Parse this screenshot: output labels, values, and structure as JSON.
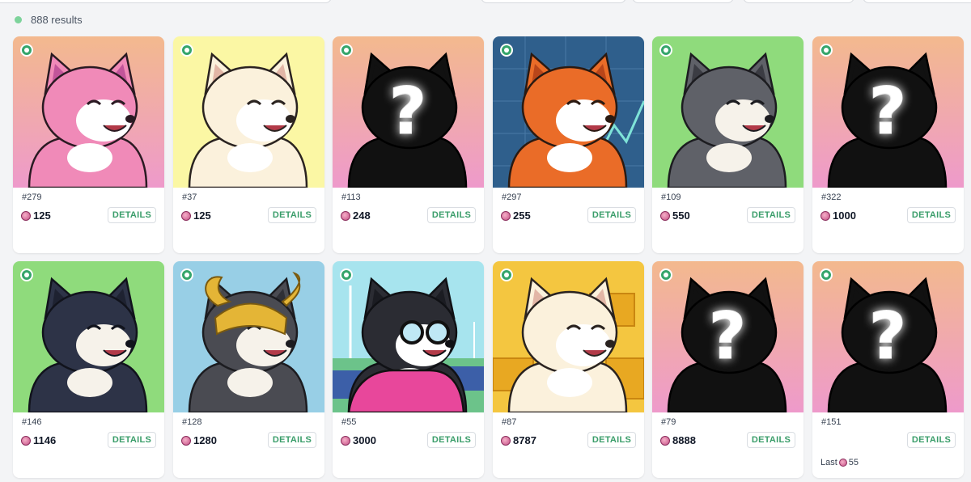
{
  "results_label": "888 results",
  "colors": {
    "accent": "#35a56b",
    "details_text": "#3a9d6a"
  },
  "cards": [
    {
      "id": "#279",
      "price": "125",
      "details": "DETAILS",
      "bg": "peach",
      "fox": "pink",
      "mask": false
    },
    {
      "id": "#37",
      "price": "125",
      "details": "DETAILS",
      "bg": "yellow",
      "fox": "cream",
      "mask": false
    },
    {
      "id": "#113",
      "price": "248",
      "details": "DETAILS",
      "bg": "peach",
      "fox": "unrevealed",
      "mask": true
    },
    {
      "id": "#297",
      "price": "255",
      "details": "DETAILS",
      "bg": "stock-chart",
      "fox": "orange",
      "mask": false
    },
    {
      "id": "#109",
      "price": "550",
      "details": "DETAILS",
      "bg": "green",
      "fox": "gray",
      "mask": false
    },
    {
      "id": "#322",
      "price": "1000",
      "details": "DETAILS",
      "bg": "peach",
      "fox": "unrevealed",
      "mask": true
    },
    {
      "id": "#146",
      "price": "1146",
      "details": "DETAILS",
      "bg": "green",
      "fox": "navy",
      "mask": false
    },
    {
      "id": "#128",
      "price": "1280",
      "details": "DETAILS",
      "bg": "light-blue",
      "fox": "horned-helmet",
      "mask": false
    },
    {
      "id": "#55",
      "price": "3000",
      "details": "DETAILS",
      "bg": "wind-farm",
      "fox": "glasses-hoodie",
      "mask": false
    },
    {
      "id": "#87",
      "price": "8787",
      "details": "DETAILS",
      "bg": "gold-bars",
      "fox": "cream",
      "mask": false
    },
    {
      "id": "#79",
      "price": "8888",
      "details": "DETAILS",
      "bg": "peach",
      "fox": "unrevealed",
      "mask": true
    },
    {
      "id": "#151",
      "price": "",
      "details": "DETAILS",
      "bg": "peach",
      "fox": "unrevealed",
      "mask": true,
      "last_label": "Last",
      "last_price": "55"
    }
  ]
}
